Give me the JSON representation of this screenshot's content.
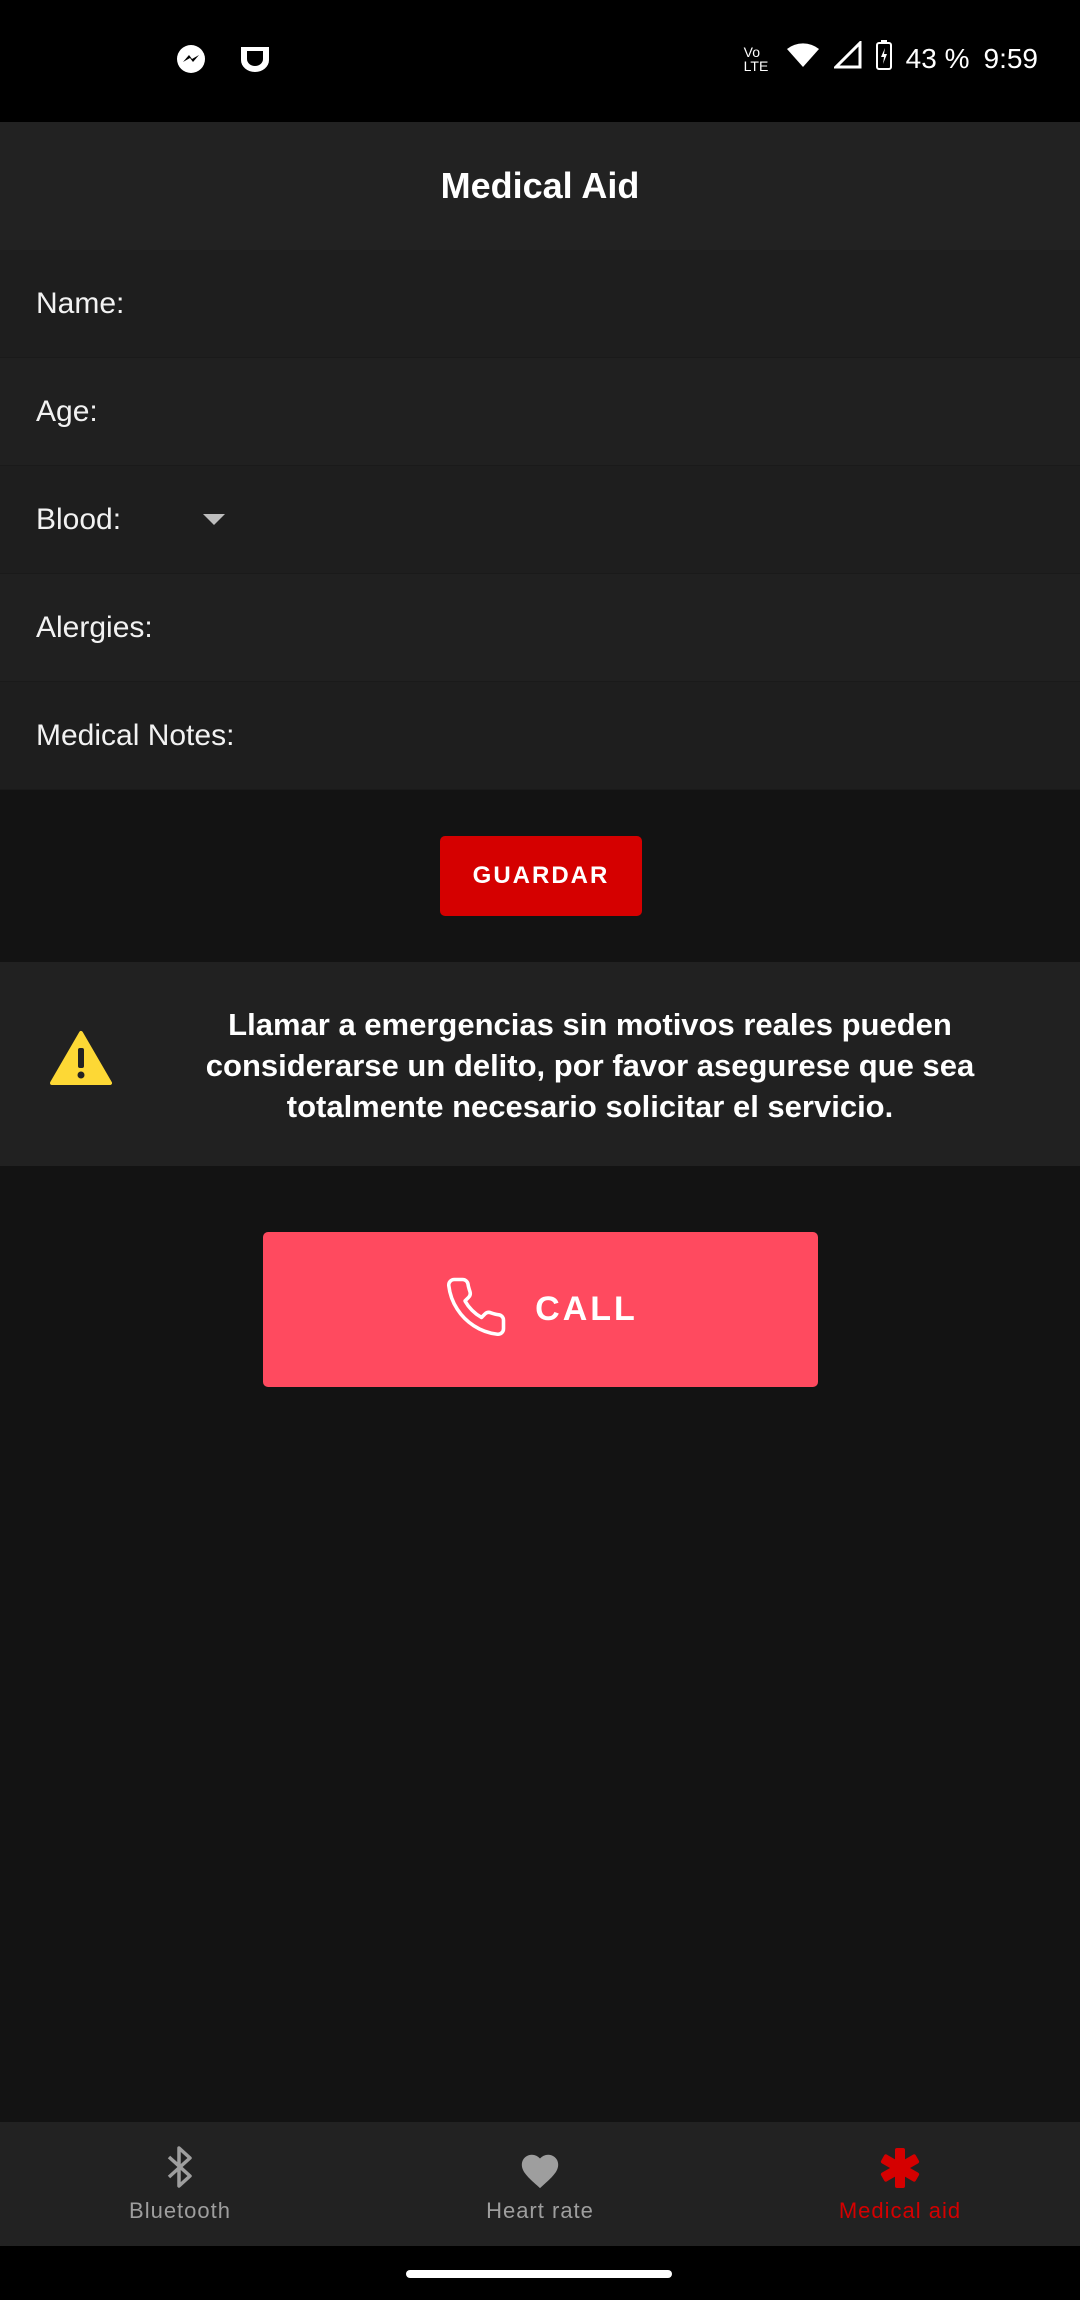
{
  "status_bar": {
    "battery": "43 %",
    "time": "9:59",
    "network_label": "Vo LTE",
    "icons": [
      "messenger-icon",
      "app-notification-icon",
      "volte-icon",
      "wifi-icon",
      "cell-signal-icon",
      "battery-charging-icon"
    ]
  },
  "app_bar": {
    "title": "Medical Aid"
  },
  "form": {
    "name_label": "Name:",
    "age_label": "Age:",
    "blood_label": "Blood:",
    "allergies_label": "Alergies:",
    "notes_label": "Medical Notes:"
  },
  "save_button": {
    "label": "GUARDAR",
    "color": "#d50000"
  },
  "warning": {
    "text": "Llamar a emergencias sin motivos reales pueden considerarse un delito, por favor asegurese que sea totalmente necesario solicitar el servicio.",
    "icon": "warning-icon",
    "icon_color": "#fdd835"
  },
  "call_button": {
    "label": "CALL",
    "icon": "phone-icon",
    "color": "#ff4a5f"
  },
  "bottom_nav": {
    "items": [
      {
        "label": "Bluetooth",
        "icon": "bluetooth-icon",
        "active": false
      },
      {
        "label": "Heart rate",
        "icon": "heart-icon",
        "active": false
      },
      {
        "label": "Medical aid",
        "icon": "medical-asterisk-icon",
        "active": true
      }
    ],
    "active_color": "#d50000",
    "inactive_color": "#9e9e9e"
  }
}
